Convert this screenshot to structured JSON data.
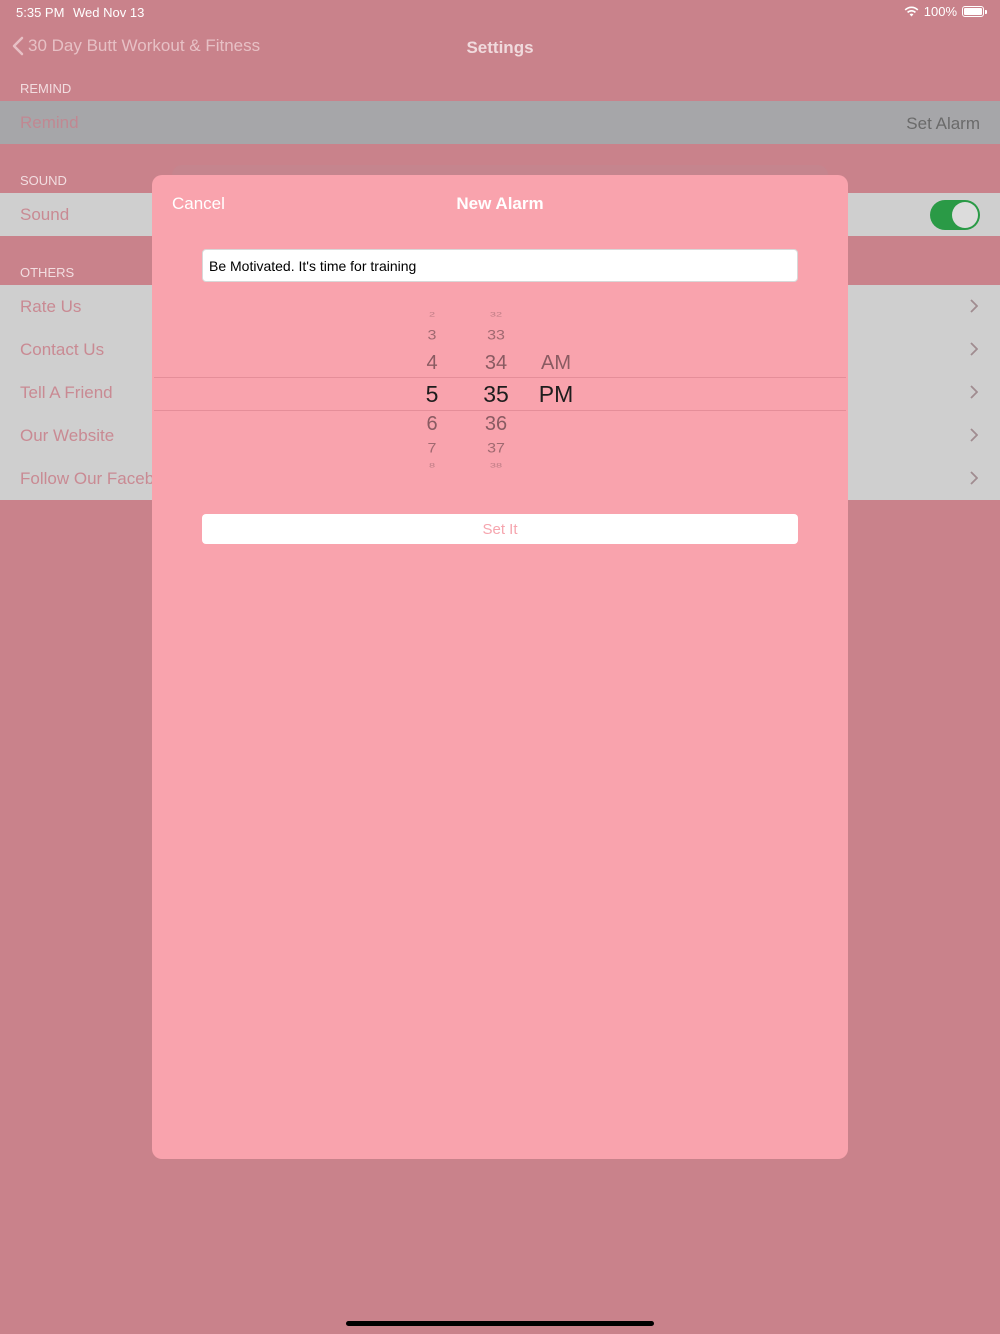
{
  "status": {
    "time": "5:35 PM",
    "date": "Wed Nov 13",
    "battery": "100%"
  },
  "nav": {
    "back_label": "30 Day Butt Workout & Fitness",
    "title": "Settings"
  },
  "sections": {
    "remind": {
      "header": "REMIND",
      "row_label": "Remind",
      "row_value": "Set Alarm"
    },
    "sound": {
      "header": "SOUND",
      "row_label": "Sound",
      "toggle_on": true
    },
    "others": {
      "header": "OTHERS",
      "items": [
        "Rate Us",
        "Contact Us",
        "Tell A Friend",
        "Our Website",
        "Follow Our Facebo"
      ]
    }
  },
  "modal": {
    "cancel_label": "Cancel",
    "title": "New Alarm",
    "message_value": "Be Motivated. It's time for training",
    "hours": [
      "2",
      "3",
      "4",
      "5",
      "6",
      "7",
      "8"
    ],
    "minutes": [
      "32",
      "33",
      "34",
      "35",
      "36",
      "37",
      "38"
    ],
    "periods": [
      "AM",
      "PM"
    ],
    "selected": {
      "hour": "5",
      "minute": "35",
      "period": "PM"
    },
    "set_label": "Set It"
  },
  "colors": {
    "accent_pink": "#f9a3ad",
    "toggle_green": "#2a9a46"
  }
}
